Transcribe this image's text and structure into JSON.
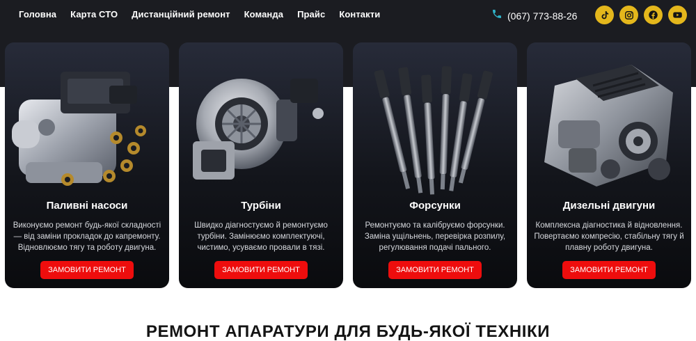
{
  "nav": {
    "items": [
      {
        "label": "Головна"
      },
      {
        "label": "Карта СТО"
      },
      {
        "label": "Дистанційний ремонт"
      },
      {
        "label": "Команда"
      },
      {
        "label": "Прайс"
      },
      {
        "label": "Контакти"
      }
    ]
  },
  "contact": {
    "phone": "(067) 773-88-26",
    "phone_icon": "phone-icon"
  },
  "socials": [
    {
      "icon": "tiktok-icon"
    },
    {
      "icon": "instagram-icon"
    },
    {
      "icon": "facebook-icon"
    },
    {
      "icon": "youtube-icon"
    }
  ],
  "services": [
    {
      "title": "Паливні насоси",
      "description": "Виконуємо ремонт будь-якої складності — від заміни прокладок до капремонту. Відновлюємо тягу та роботу двигуна.",
      "button": "ЗАМОВИТИ РЕМОНТ",
      "image": "fuel-pump-image"
    },
    {
      "title": "Турбіни",
      "description": "Швидко діагностуємо й ремонтуємо турбіни. Замінюємо комплектуючі, чистимо, усуваємо провали в тязі.",
      "button": "ЗАМОВИТИ РЕМОНТ",
      "image": "turbine-image"
    },
    {
      "title": "Форсунки",
      "description": "Ремонтуємо та калібруємо форсунки. Заміна ущільнень, перевірка розпилу, регулювання подачі пального.",
      "button": "ЗАМОВИТИ РЕМОНТ",
      "image": "injectors-image"
    },
    {
      "title": "Дизельні двигуни",
      "description": "Комплексна діагностика й відновлення. Повертаємо компресію, стабільну тягу й плавну роботу двигуна.",
      "button": "ЗАМОВИТИ РЕМОНТ",
      "image": "diesel-engine-image"
    }
  ],
  "section": {
    "heading": "РЕМОНТ АПАРАТУРИ ДЛЯ БУДЬ-ЯКОЇ ТЕХНІКИ"
  },
  "colors": {
    "header_bg": "#1b1c21",
    "accent_gold": "#e4b71c",
    "cta_red": "#ee0d0d",
    "phone_icon": "#2fb3c9"
  }
}
